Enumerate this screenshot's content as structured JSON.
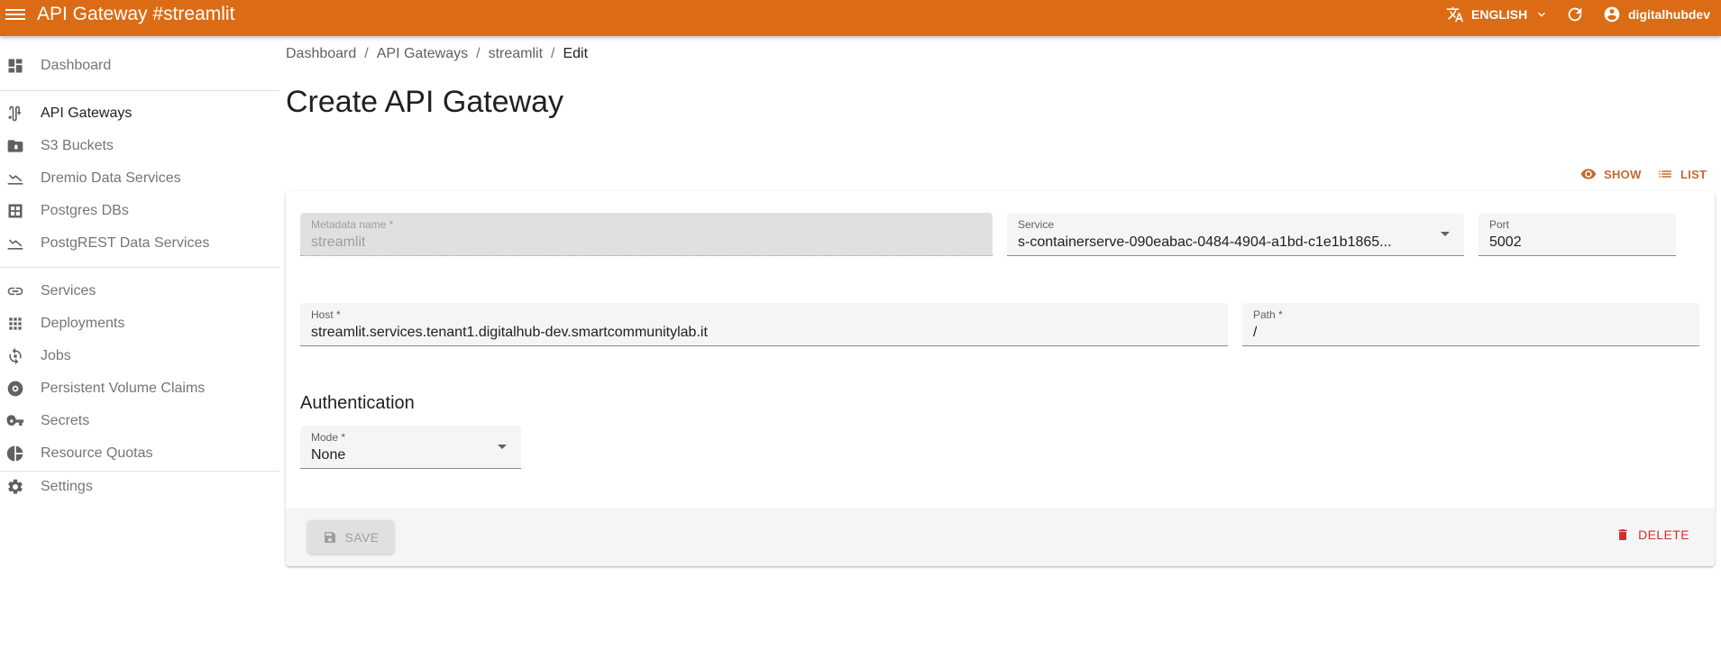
{
  "appbar": {
    "title": "API Gateway #streamlit",
    "language": "ENGLISH",
    "username": "digitalhubdev",
    "icons": {
      "menu": "menu-icon",
      "translate": "translate-icon",
      "chevron": "chevron-down-icon",
      "refresh": "refresh-icon",
      "account": "account-circle-icon"
    },
    "color": "#dc6b15"
  },
  "sidebar": {
    "items": [
      {
        "label": "Dashboard",
        "icon": "dashboard-icon"
      },
      {
        "label": "API Gateways",
        "icon": "api-icon"
      },
      {
        "label": "S3 Buckets",
        "icon": "folder-icon"
      },
      {
        "label": "Dremio Data Services",
        "icon": "chart-line-icon"
      },
      {
        "label": "Postgres DBs",
        "icon": "database-grid-icon"
      },
      {
        "label": "PostgREST Data Services",
        "icon": "chart-line-icon"
      },
      {
        "label": "Services",
        "icon": "link-icon"
      },
      {
        "label": "Deployments",
        "icon": "apps-grid-icon"
      },
      {
        "label": "Jobs",
        "icon": "cycle-icon"
      },
      {
        "label": "Persistent Volume Claims",
        "icon": "disc-icon"
      },
      {
        "label": "Secrets",
        "icon": "key-icon"
      },
      {
        "label": "Resource Quotas",
        "icon": "pie-chart-icon"
      },
      {
        "label": "Settings",
        "icon": "gear-icon"
      }
    ],
    "active_index": 1
  },
  "breadcrumb": [
    "Dashboard",
    "API Gateways",
    "streamlit",
    "Edit"
  ],
  "page_title": "Create API Gateway",
  "actions": {
    "show": "SHOW",
    "list": "LIST"
  },
  "form": {
    "metadata_name": {
      "label": "Metadata name *",
      "value": "streamlit"
    },
    "service": {
      "label": "Service",
      "value": "s-containerserve-090eabac-0484-4904-a1bd-c1e1b1865..."
    },
    "port": {
      "label": "Port",
      "value": "5002"
    },
    "host": {
      "label": "Host *",
      "value": "streamlit.services.tenant1.digitalhub-dev.smartcommunitylab.it"
    },
    "path": {
      "label": "Path *",
      "value": "/"
    },
    "auth_section": "Authentication",
    "mode": {
      "label": "Mode *",
      "value": "None"
    }
  },
  "toolbar": {
    "save_label": "SAVE",
    "delete_label": "DELETE"
  },
  "colors": {
    "accent": "#dc6b15",
    "action": "#c26a30",
    "danger": "#d32f2f"
  }
}
